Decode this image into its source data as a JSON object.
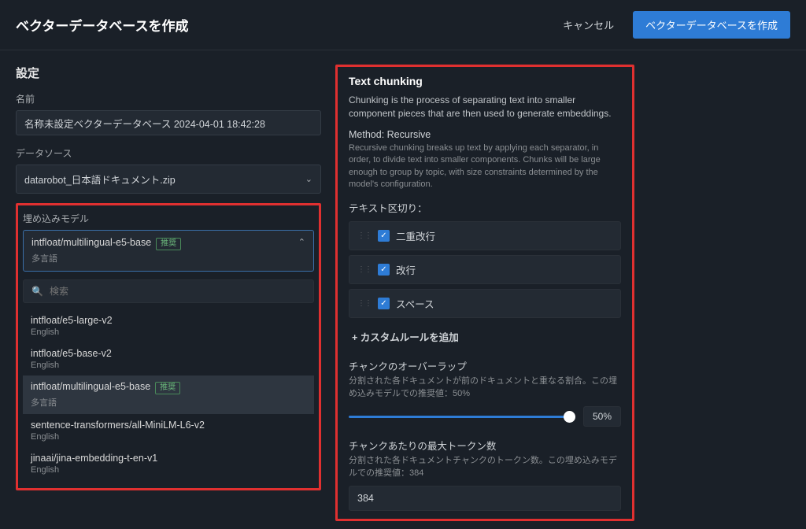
{
  "header": {
    "title": "ベクターデータベースを作成",
    "cancel": "キャンセル",
    "submit": "ベクターデータベースを作成"
  },
  "settings": {
    "heading": "設定",
    "name_label": "名前",
    "name_value": "名称未設定ベクターデータベース 2024-04-01 18:42:28",
    "source_label": "データソース",
    "source_value": "datarobot_日本語ドキュメント.zip",
    "embed_label": "埋め込みモデル",
    "selected_model": "intfloat/multilingual-e5-base",
    "selected_sub": "多言語",
    "recommended": "推奨",
    "search_placeholder": "検索",
    "options": [
      {
        "name": "intfloat/e5-large-v2",
        "sub": "English"
      },
      {
        "name": "intfloat/e5-base-v2",
        "sub": "English"
      },
      {
        "name": "intfloat/multilingual-e5-base",
        "sub": "多言語",
        "recommended": true,
        "active": true
      },
      {
        "name": "sentence-transformers/all-MiniLM-L6-v2",
        "sub": "English"
      },
      {
        "name": "jinaai/jina-embedding-t-en-v1",
        "sub": "English"
      }
    ]
  },
  "chunking": {
    "title": "Text chunking",
    "desc": "Chunking is the process of separating text into smaller component pieces that are then used to generate embeddings.",
    "method_label": "Method: Recursive",
    "method_desc": "Recursive chunking breaks up text by applying each separator, in order, to divide text into smaller components. Chunks will be large enough to group by topic, with size constraints determined by the model's configuration.",
    "sep_label": "テキスト区切り：",
    "separators": [
      "二重改行",
      "改行",
      "スペース"
    ],
    "add_rule": "+ カスタムルールを追加",
    "overlap_label": "チャンクのオーバーラップ",
    "overlap_desc": "分割された各ドキュメントが前のドキュメントと重なる割合。この埋め込みモデルでの推奨値：50%",
    "overlap_value": "50%",
    "tokens_label": "チャンクあたりの最大トークン数",
    "tokens_desc": "分割された各ドキュメントチャンクのトークン数。この埋め込みモデルでの推奨値：384",
    "tokens_value": "384"
  }
}
